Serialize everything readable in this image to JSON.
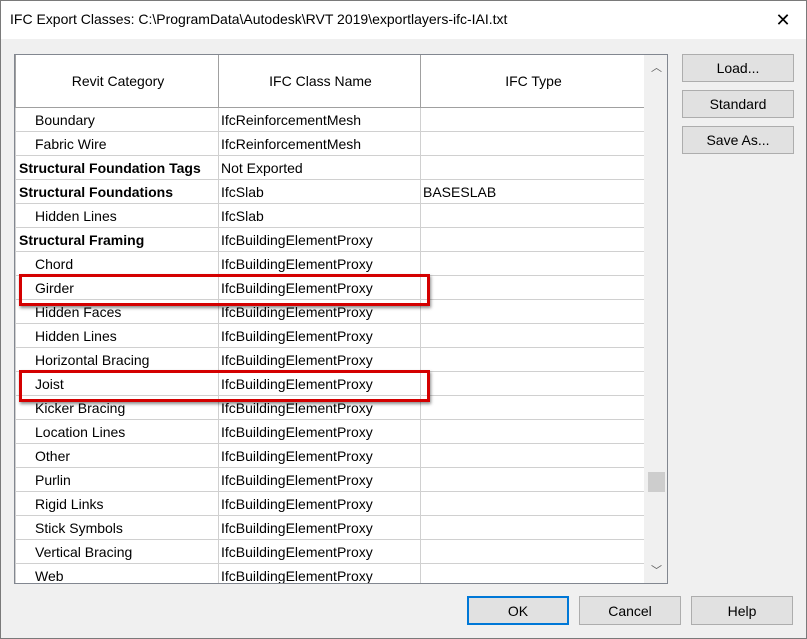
{
  "window": {
    "title": "IFC Export Classes: C:\\ProgramData\\Autodesk\\RVT 2019\\exportlayers-ifc-IAI.txt",
    "close_glyph": "✕"
  },
  "grid": {
    "headers": [
      "Revit Category",
      "IFC Class Name",
      "IFC Type"
    ],
    "rows": [
      {
        "category": "Boundary",
        "class_name": "IfcReinforcementMesh",
        "type": "",
        "level": "sub"
      },
      {
        "category": "Fabric Wire",
        "class_name": "IfcReinforcementMesh",
        "type": "",
        "level": "sub"
      },
      {
        "category": "Structural Foundation Tags",
        "class_name": "Not Exported",
        "type": "",
        "level": "bold"
      },
      {
        "category": "Structural Foundations",
        "class_name": "IfcSlab",
        "type": "BASESLAB",
        "level": "bold"
      },
      {
        "category": "Hidden Lines",
        "class_name": "IfcSlab",
        "type": "",
        "level": "sub"
      },
      {
        "category": "Structural Framing",
        "class_name": "IfcBuildingElementProxy",
        "type": "",
        "level": "bold"
      },
      {
        "category": "Chord",
        "class_name": "IfcBuildingElementProxy",
        "type": "",
        "level": "sub"
      },
      {
        "category": "Girder",
        "class_name": "IfcBuildingElementProxy",
        "type": "",
        "level": "sub"
      },
      {
        "category": "Hidden Faces",
        "class_name": "IfcBuildingElementProxy",
        "type": "",
        "level": "sub"
      },
      {
        "category": "Hidden Lines",
        "class_name": "IfcBuildingElementProxy",
        "type": "",
        "level": "sub"
      },
      {
        "category": "Horizontal Bracing",
        "class_name": "IfcBuildingElementProxy",
        "type": "",
        "level": "sub"
      },
      {
        "category": "Joist",
        "class_name": "IfcBuildingElementProxy",
        "type": "",
        "level": "sub"
      },
      {
        "category": "Kicker Bracing",
        "class_name": "IfcBuildingElementProxy",
        "type": "",
        "level": "sub"
      },
      {
        "category": "Location Lines",
        "class_name": "IfcBuildingElementProxy",
        "type": "",
        "level": "sub"
      },
      {
        "category": "Other",
        "class_name": "IfcBuildingElementProxy",
        "type": "",
        "level": "sub"
      },
      {
        "category": "Purlin",
        "class_name": "IfcBuildingElementProxy",
        "type": "",
        "level": "sub"
      },
      {
        "category": "Rigid Links",
        "class_name": "IfcBuildingElementProxy",
        "type": "",
        "level": "sub"
      },
      {
        "category": "Stick Symbols",
        "class_name": "IfcBuildingElementProxy",
        "type": "",
        "level": "sub"
      },
      {
        "category": "Vertical Bracing",
        "class_name": "IfcBuildingElementProxy",
        "type": "",
        "level": "sub"
      },
      {
        "category": "Web",
        "class_name": "IfcBuildingElementProxy",
        "type": "",
        "level": "sub"
      }
    ],
    "highlighted_rows": [
      "Girder",
      "Joist"
    ],
    "highlight_color": "#d40000"
  },
  "scrollbar": {
    "up_glyph": "︿",
    "down_glyph": "﹀"
  },
  "side_buttons": {
    "load": "Load...",
    "standard": "Standard",
    "save_as": "Save As..."
  },
  "footer_buttons": {
    "ok": "OK",
    "cancel": "Cancel",
    "help": "Help"
  }
}
